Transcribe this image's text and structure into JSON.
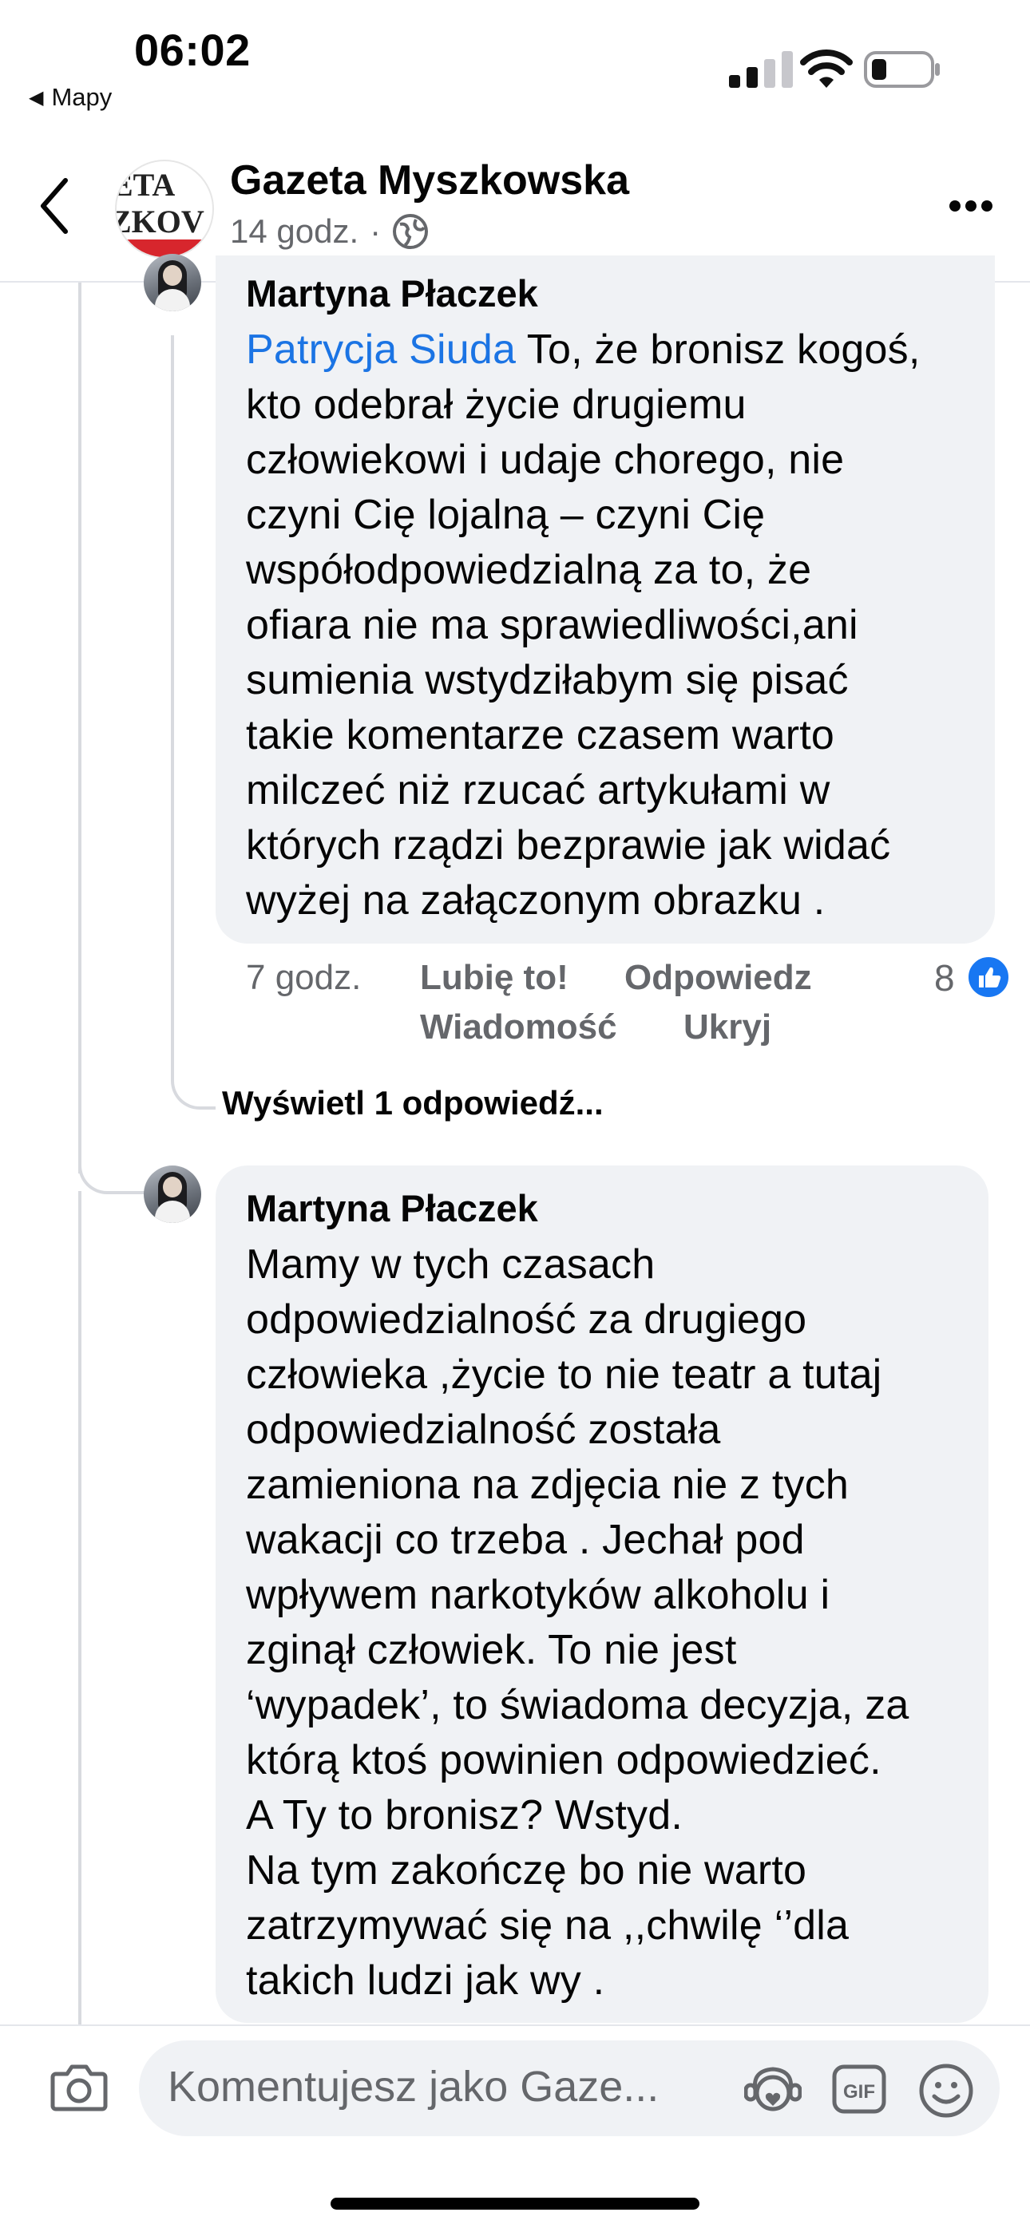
{
  "status_bar": {
    "time": "06:02",
    "back_app": "Mapy"
  },
  "header": {
    "page_name": "Gazeta Myszkowska",
    "post_age": "14 godz.",
    "separator": "·",
    "avatar_text_top": "ETA",
    "avatar_text_bottom": "ZKOV"
  },
  "comments": [
    {
      "author": "Martyna Płaczek",
      "mention": "Patrycja Siuda",
      "text_lines": [
        " To, że bronisz kogoś,",
        "kto odebrał życie drugiemu",
        "człowiekowi i udaje chorego, nie",
        "czyni Cię lojalną – czyni Cię",
        "współodpowiedzialną za to, że",
        "ofiara nie ma sprawiedliwości,ani",
        "sumienia wstydziłabym się pisać",
        "takie komentarze czasem warto",
        "milczeć niż rzucać artykułami w",
        "których rządzi bezprawie jak widać",
        "wyżej na załączonym obrazku ."
      ],
      "time": "7 godz.",
      "actions": {
        "like": "Lubię to!",
        "reply": "Odpowiedz",
        "message": "Wiadomość",
        "hide": "Ukryj"
      },
      "reaction_count": "8",
      "view_replies": "Wyświetl 1 odpowiedź..."
    },
    {
      "author": "Martyna Płaczek",
      "text_lines": [
        "Mamy w tych czasach",
        "odpowiedzialność za drugiego",
        "człowieka ,życie to nie teatr a tutaj",
        "odpowiedzialność została",
        "zamieniona na zdjęcia nie z tych",
        "wakacji co trzeba . Jechał pod",
        "wpływem narkotyków alkoholu i",
        "zginął człowiek. To nie jest",
        "‘wypadek’, to świadoma decyzja, za",
        "którą ktoś powinien odpowiedzieć.",
        "A Ty to bronisz? Wstyd.",
        "Na tym zakończę bo nie warto",
        "zatrzymywać się na ,,chwilę ‘’dla",
        "takich ludzi jak wy ."
      ]
    }
  ],
  "composer": {
    "placeholder": "Komentujesz jako Gaze..."
  },
  "colors": {
    "accent": "#1877f2",
    "mention": "#1b74e4",
    "bubble": "#f0f2f5",
    "secondary_text": "#65676b"
  }
}
